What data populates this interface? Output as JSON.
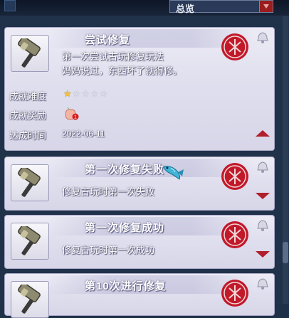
{
  "header": {
    "filter_label": "总览",
    "filter_arrow_icon": "chevron-down-icon"
  },
  "expanded": {
    "title": "尝试修复",
    "desc_line1": "第一次尝试古玩修复玩法",
    "desc_line2": "妈妈说过，东西坏了就得修。",
    "difficulty_label": "成就难度",
    "difficulty_stars": 1,
    "difficulty_max": 5,
    "reward_label": "成就奖励",
    "reward_icon": "peach-icon",
    "reward_badge": "1",
    "date_label": "达成时间",
    "date_value": "2022-06-11"
  },
  "achievements": [
    {
      "title": "第一次修复失败",
      "desc": "修复古玩时第一次失败"
    },
    {
      "title": "第一次修复成功",
      "desc": "修复古玩时第一次成功"
    },
    {
      "title": "第10次进行修复",
      "desc": ""
    }
  ],
  "colors": {
    "accent_red": "#b01f2a",
    "star_gold": "#f4c23a",
    "panel_bg": "#e6e5f2"
  }
}
